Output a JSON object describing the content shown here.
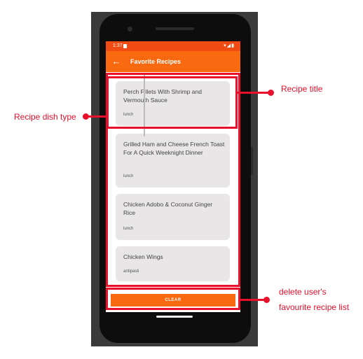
{
  "status_bar": {
    "time": "1:37",
    "icons": "▾◢▮"
  },
  "app_bar": {
    "back_icon": "←",
    "title": "Favorite Recipes"
  },
  "recipes": [
    {
      "title": "Perch Fillets With Shrimp and Vermouth Sauce",
      "dish_type": "lunch"
    },
    {
      "title": "Grilled Ham and Cheese French Toast For A Quick Weeknight Dinner",
      "dish_type": "lunch"
    },
    {
      "title": "Chicken Adobo & Coconut Ginger Rice",
      "dish_type": "lunch"
    },
    {
      "title": "Chicken Wings",
      "dish_type": "antipasti"
    }
  ],
  "clear_button": {
    "label": "CLEAR"
  },
  "annotations": {
    "recipe_title": "Recipe title",
    "recipe_dish_type": "Recipe dish type",
    "delete_line1": "delete user's",
    "delete_line2": "favourite recipe list"
  },
  "colors": {
    "primary": "#f96a10",
    "status_bar": "#f04b12",
    "annotation": "#e8102a"
  }
}
